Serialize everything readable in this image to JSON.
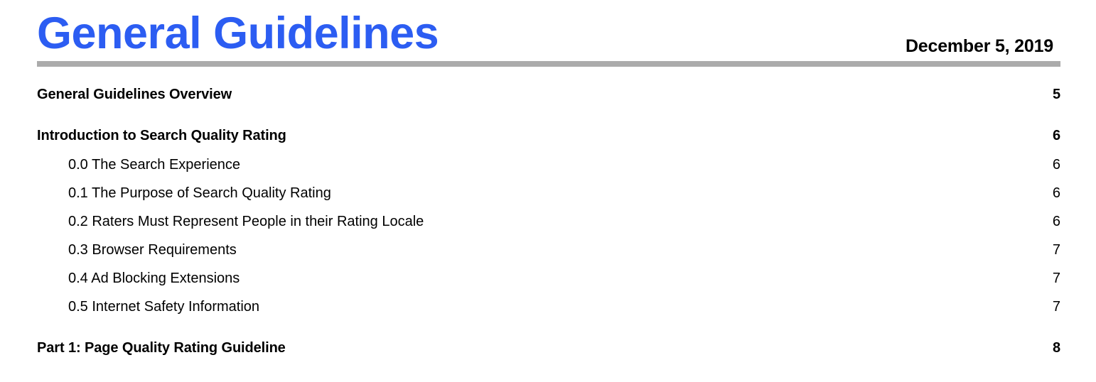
{
  "document": {
    "title": "General Guidelines",
    "date": "December 5, 2019",
    "title_color": "#2C5DF2",
    "rule_color": "#ABABAB"
  },
  "toc": {
    "rows": [
      {
        "label": "General Guidelines Overview",
        "page": "5",
        "level": 1
      },
      {
        "label": "Introduction to Search Quality Rating",
        "page": "6",
        "level": 1
      },
      {
        "label": "0.0 The Search Experience",
        "page": "6",
        "level": 2
      },
      {
        "label": "0.1 The Purpose of Search Quality Rating",
        "page": "6",
        "level": 2
      },
      {
        "label": "0.2 Raters Must Represent People in their Rating Locale",
        "page": "6",
        "level": 2
      },
      {
        "label": "0.3 Browser Requirements",
        "page": "7",
        "level": 2
      },
      {
        "label": "0.4 Ad Blocking Extensions",
        "page": "7",
        "level": 2
      },
      {
        "label": "0.5 Internet Safety Information",
        "page": "7",
        "level": 2
      },
      {
        "label": "Part 1: Page Quality Rating Guideline",
        "page": "8",
        "level": 1
      }
    ]
  }
}
